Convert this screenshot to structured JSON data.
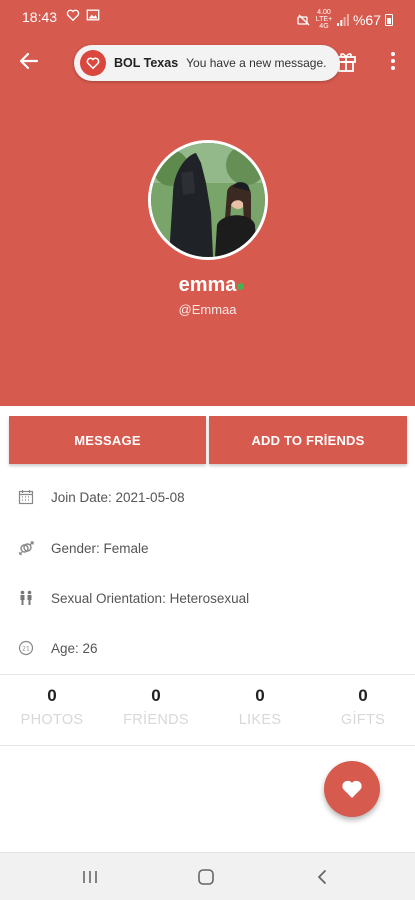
{
  "status_bar": {
    "time": "18:43",
    "network_top": "4.00",
    "network_bottom": "LTE+ 4G",
    "battery": "%67"
  },
  "toast": {
    "app_name": "BOL Texas",
    "message": "You have a new message."
  },
  "profile": {
    "name": "emma",
    "username": "@Emmaa"
  },
  "actions": {
    "message_label": "MESSAGE",
    "add_friend_label": "ADD TO FRİENDS"
  },
  "info": [
    {
      "icon": "calendar-icon",
      "text": "Join Date: 2021-05-08"
    },
    {
      "icon": "gender-icon",
      "text": "Gender: Female"
    },
    {
      "icon": "couple-icon",
      "text": "Sexual Orientation: Heterosexual"
    },
    {
      "icon": "age-icon",
      "text": "Age: 26"
    }
  ],
  "stats": [
    {
      "value": "0",
      "label": "PHOTOS"
    },
    {
      "value": "0",
      "label": "FRİENDS"
    },
    {
      "value": "0",
      "label": "LIKES"
    },
    {
      "value": "0",
      "label": "GİFTS"
    }
  ],
  "colors": {
    "primary": "#d75a4e",
    "online": "#4caf50",
    "stat_label": "#d8d8d8"
  },
  "icons": {
    "back": "arrow-left-icon",
    "gift": "gift-icon",
    "more": "more-vertical-icon",
    "fab": "heart-icon",
    "nav_recent": "recent-apps-icon",
    "nav_home": "home-icon",
    "nav_back": "nav-back-icon"
  }
}
